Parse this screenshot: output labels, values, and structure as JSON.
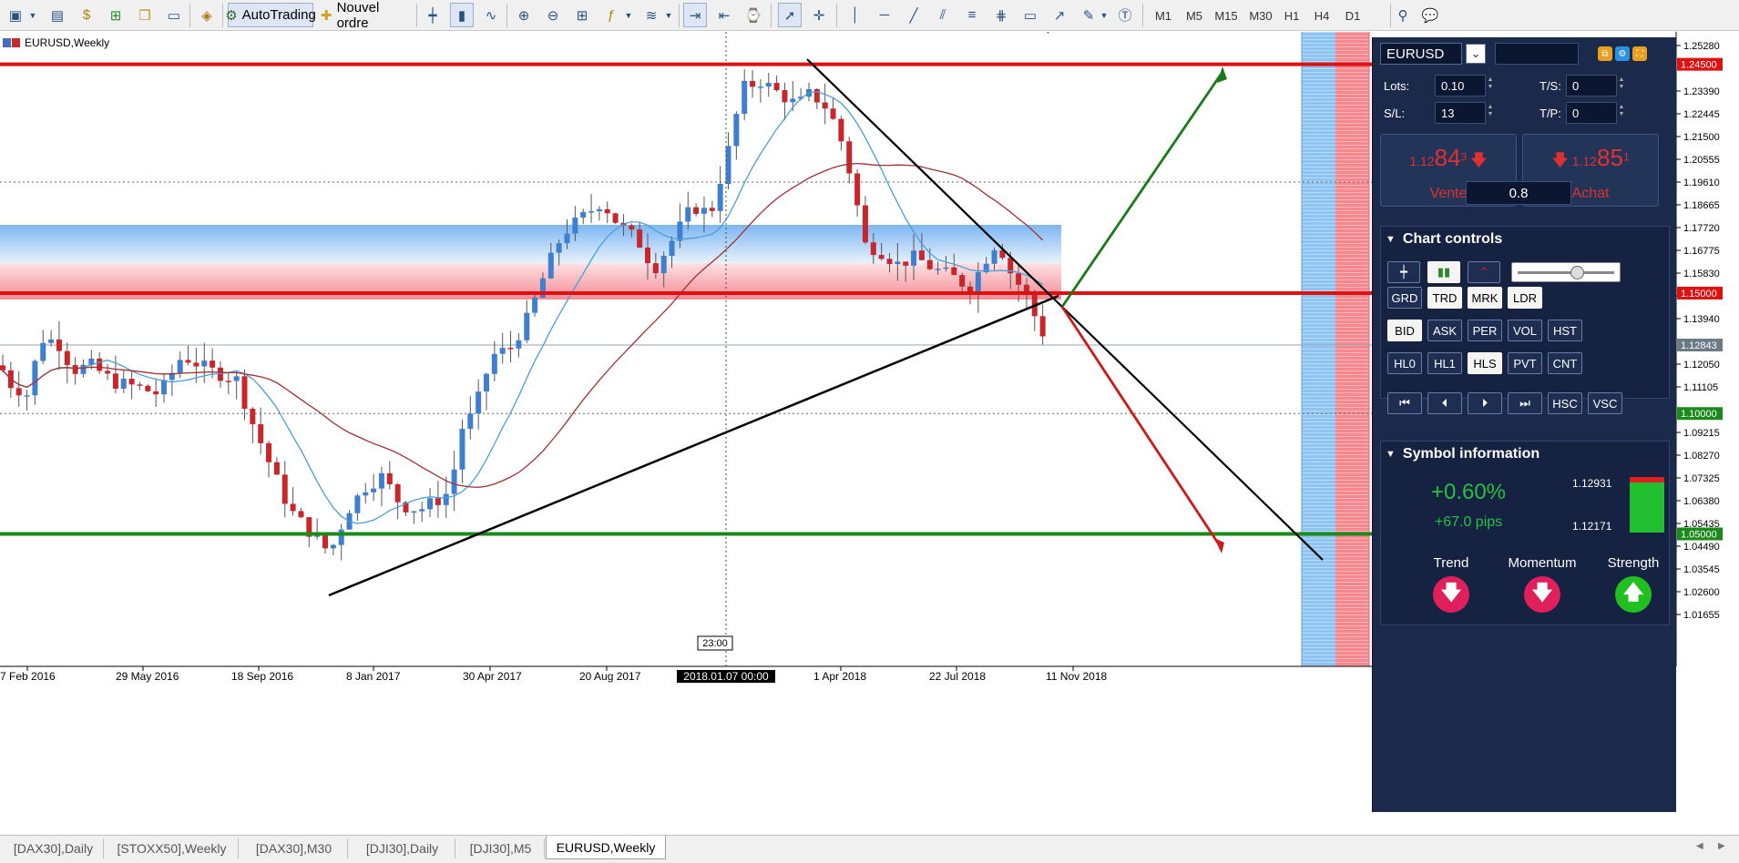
{
  "toolbar": {
    "autotrading_label": "AutoTrading",
    "neworder_label": "Nouvel ordre",
    "timeframes": [
      "M1",
      "M5",
      "M15",
      "M30",
      "H1",
      "H4",
      "D1"
    ]
  },
  "chart": {
    "title": "EURUSD,Weekly",
    "price_ticks": [
      "1.25280",
      "1.23390",
      "1.22445",
      "1.21500",
      "1.20555",
      "1.19610",
      "1.18665",
      "1.17720",
      "1.16775",
      "1.15830",
      "1.14885",
      "1.13940",
      "1.12050",
      "1.11105",
      "1.09215",
      "1.08270",
      "1.07325",
      "1.06380",
      "1.05435",
      "1.04490",
      "1.03545",
      "1.02600",
      "1.01655"
    ],
    "price_labels": [
      {
        "text": "1.24500",
        "color": "#e01010",
        "price": 1.245
      },
      {
        "text": "1.15000",
        "color": "#e01010",
        "price": 1.15
      },
      {
        "text": "1.12843",
        "color": "#6c7a86",
        "price": 1.12843
      },
      {
        "text": "1.10000",
        "color": "#1a8a1a",
        "price": 1.1
      },
      {
        "text": "1.05000",
        "color": "#1a8a1a",
        "price": 1.05
      }
    ],
    "time_labels": [
      "7 Feb 2016",
      "29 May 2016",
      "18 Sep 2016",
      "8 Jan 2017",
      "30 Apr 2017",
      "20 Aug 2017",
      "1 Apr 2018",
      "22 Jul 2018",
      "11 Nov 2018"
    ],
    "crosshair_time": "2018.01.07 00:00",
    "crosshair_marker": "23:00"
  },
  "panel": {
    "symbol": "EURUSD",
    "lots_label": "Lots:",
    "lots_value": "0.10",
    "ts_label": "T/S:",
    "ts_value": "0",
    "sl_label": "S/L:",
    "sl_value": "13",
    "tp_label": "T/P:",
    "tp_value": "0",
    "sell": {
      "small": "1.12",
      "big": "84",
      "sup": "3",
      "label": "Vente"
    },
    "buy": {
      "small": "1.12",
      "big": "85",
      "sup": "1",
      "label": "Achat"
    },
    "spread": "0.8",
    "chart_controls_title": "Chart controls",
    "row1": [
      "GRD",
      "TRD",
      "MRK",
      "LDR"
    ],
    "row2": [
      "BID",
      "ASK",
      "PER",
      "VOL",
      "HST"
    ],
    "row3": [
      "HL0",
      "HL1",
      "HLS",
      "PVT",
      "CNT"
    ],
    "row4_text": [
      "HSC",
      "VSC"
    ],
    "symbol_info_title": "Symbol information",
    "change_pct": "+0.60%",
    "change_pips": "+67.0 pips",
    "range_high": "1.12931",
    "range_low": "1.12171",
    "trend_label": "Trend",
    "momentum_label": "Momentum",
    "strength_label": "Strength"
  },
  "tabs": [
    "[DAX30],Daily",
    "[STOXX50],Weekly",
    "[DAX30],M30",
    "[DJI30],Daily",
    "[DJI30],M5",
    "EURUSD,Weekly"
  ],
  "colors": {
    "up": "#3f7fd0",
    "down": "#c8262a",
    "ma_fast": "#4a9fd8",
    "ma_slow": "#a33030",
    "panel_bg": "#1b2a4a"
  }
}
